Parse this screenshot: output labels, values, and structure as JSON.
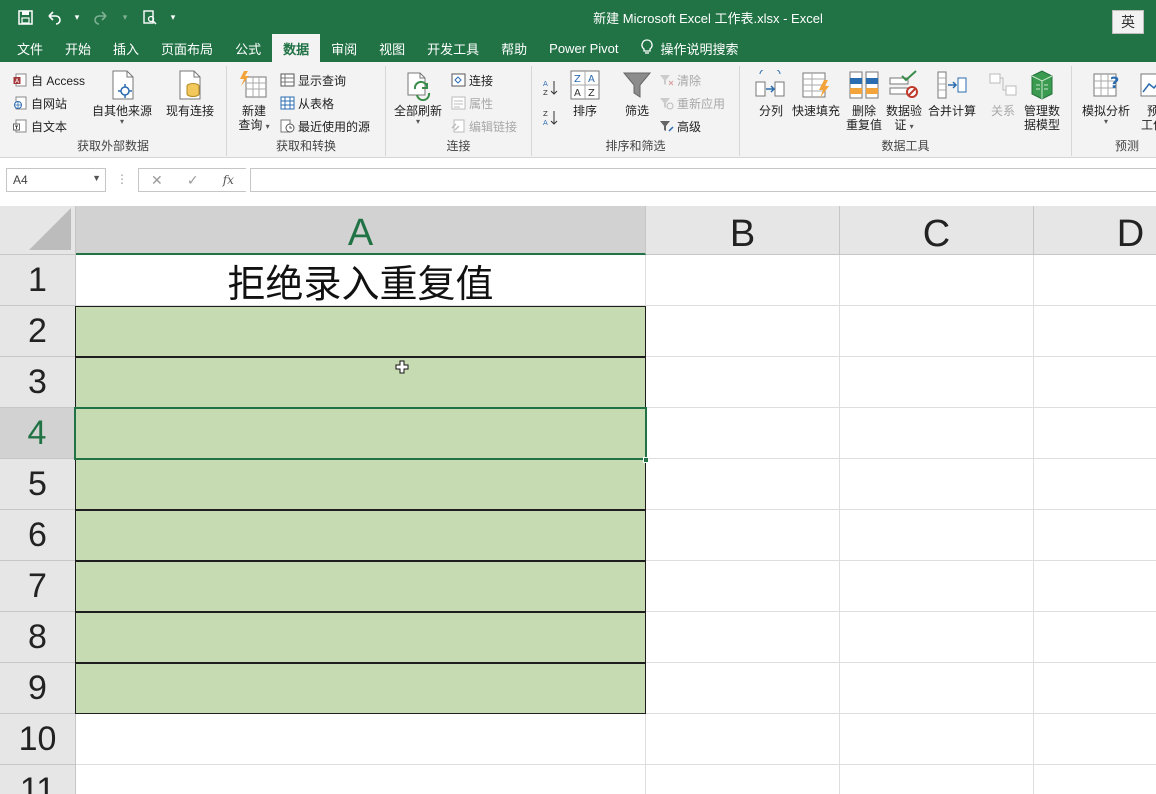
{
  "window": {
    "title": "新建 Microsoft Excel 工作表.xlsx  -  Excel",
    "ime_indicator": "英"
  },
  "qat": {
    "save_icon": "save-icon",
    "undo_icon": "undo-icon",
    "redo_icon": "redo-icon",
    "preview_icon": "print-preview-icon"
  },
  "tabs": [
    {
      "label": "文件"
    },
    {
      "label": "开始"
    },
    {
      "label": "插入"
    },
    {
      "label": "页面布局"
    },
    {
      "label": "公式"
    },
    {
      "label": "数据",
      "active": true
    },
    {
      "label": "审阅"
    },
    {
      "label": "视图"
    },
    {
      "label": "开发工具"
    },
    {
      "label": "帮助"
    },
    {
      "label": "Power Pivot"
    },
    {
      "label": "操作说明搜索"
    }
  ],
  "ribbon": {
    "external": {
      "label": "获取外部数据",
      "access": "自 Access",
      "web": "自网站",
      "text": "自文本",
      "other_sources": "自其他来源",
      "existing": "现有连接"
    },
    "transform": {
      "label": "获取和转换",
      "new_query_1": "新建",
      "new_query_2": "查询",
      "show_queries": "显示查询",
      "from_table": "从表格",
      "recent_sources": "最近使用的源"
    },
    "connections": {
      "label": "连接",
      "refresh_all": "全部刷新",
      "connections": "连接",
      "properties": "属性",
      "edit_links": "编辑链接"
    },
    "sort_filter": {
      "label": "排序和筛选",
      "sort": "排序",
      "filter": "筛选",
      "clear": "清除",
      "reapply": "重新应用",
      "advanced": "高级"
    },
    "data_tools": {
      "label": "数据工具",
      "text_to_columns": "分列",
      "flash_fill": "快速填充",
      "remove_dup_1": "删除",
      "remove_dup_2": "重复值",
      "validation_1": "数据验",
      "validation_2": "证",
      "consolidate": "合并计算",
      "relationships": "关系",
      "manage_model_1": "管理数",
      "manage_model_2": "据模型"
    },
    "forecast": {
      "label": "预测",
      "what_if": "模拟分析",
      "forecast_sheet_1": "预",
      "forecast_sheet_2": "工作"
    }
  },
  "formula_bar": {
    "name_box": "A4",
    "cancel": "✕",
    "enter": "✓",
    "fx": "fx",
    "value": ""
  },
  "sheet": {
    "columns": [
      "A",
      "B",
      "C",
      "D"
    ],
    "rows": [
      "1",
      "2",
      "3",
      "4",
      "5",
      "6",
      "7",
      "8",
      "9",
      "10",
      "11"
    ],
    "active_cell": "A4",
    "cells": {
      "A1": "拒绝录入重复值"
    },
    "highlight_fill": "#c6dbb1",
    "accent": "#217346"
  }
}
